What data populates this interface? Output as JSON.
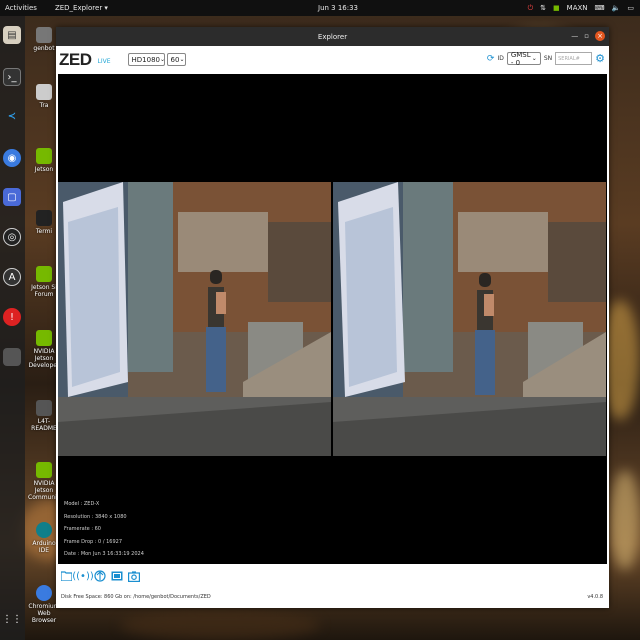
{
  "topbar": {
    "activities": "Activities",
    "app_menu": "ZED_Explorer ▾",
    "clock": "Jun 3  16:33",
    "tray_user": "MAXN"
  },
  "desktop_icons": [
    {
      "label": "genbot"
    },
    {
      "label": "Tra"
    },
    {
      "label": "Jetson"
    },
    {
      "label": "Jetson Si Forum"
    },
    {
      "label": "Termi"
    },
    {
      "label": "NVIDIA Jetson Developer"
    },
    {
      "label": "L4T-README"
    },
    {
      "label": "NVIDIA Jetson Community"
    },
    {
      "label": "Arduino IDE"
    },
    {
      "label": "Chromium Web Browser"
    }
  ],
  "window": {
    "title": "Explorer",
    "toolbar": {
      "logo": "ZED",
      "live": "LIVE",
      "resolution": "HD1080",
      "fps": "60",
      "id_label": "ID",
      "id_value": "GMSL - 0",
      "sn_label": "SN",
      "sn_placeholder": "SERIAL#"
    },
    "info": {
      "model": "Model : ZED-X",
      "resolution": "Resolution : 3840 x 1080",
      "framerate": "Framerate : 60",
      "frame_drop": "Frame Drop : 0 / 16927",
      "date": "Date : Mon Jun 3 16:33:19 2024"
    },
    "status": "Disk Free Space: 860 Gb  on: /home/genbot/Documents/ZED",
    "version": "v4.0.8"
  },
  "colors": {
    "accent": "#1a8fd0",
    "close": "#e2561f",
    "titlebar": "#2c2c2c"
  },
  "icons": [
    "folder-icon",
    "broadcast-icon",
    "gps-icon",
    "video-record-icon",
    "camera-snapshot-icon",
    "refresh-icon",
    "settings-gear-icon"
  ]
}
